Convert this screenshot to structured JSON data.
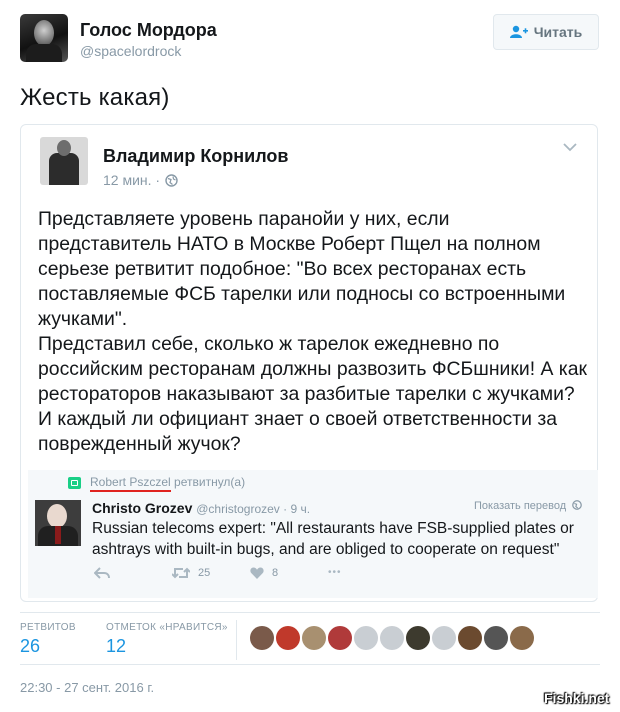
{
  "tweet": {
    "author_name": "Голос Мордора",
    "author_handle": "@spacelordrock",
    "follow_label": "Читать",
    "text": "Жесть какая)"
  },
  "quoted": {
    "name": "Владимир Корнилов",
    "time": "12 мин. ·",
    "paragraph1": "Представляете уровень паранойи у них, если представитель НАТО в Москве Роберт Пщел на полном серьезе ретвитит подобное: \"Во всех ресторанах есть поставляемые ФСБ тарелки или подносы со встроенными жучками\".",
    "paragraph2": "Представил себе, сколько ж тарелок ежедневно по российским ресторанам должны развозить ФСБшники! А как рестораторов наказывают за разбитые тарелки с жучками? И каждый ли официант знает о своей ответственности за поврежденный жучок?"
  },
  "inner": {
    "rt_user": "Robert Pszczel",
    "rt_suffix": "ретвитнул(а)",
    "name": "Christo Grozev",
    "handle": "@christogrozev · 9 ч.",
    "translate": "Показать перевод",
    "text": "Russian telecoms expert: \"All restaurants have FSB-supplied plates or ashtrays with built-in bugs, and are obliged to cooperate on request\"",
    "retweets": "25",
    "likes": "8",
    "more": "•••"
  },
  "stats": {
    "retweets_label": "РЕТВИТОВ",
    "retweets": "26",
    "likes_label": "ОТМЕТОК «НРАВИТСЯ»",
    "likes": "12"
  },
  "likers": [
    "#7a5a4a",
    "#c0392b",
    "#a89070",
    "#b03a3a",
    "#c9ced3",
    "#c9ced3",
    "#3d3a2e",
    "#c9ced3",
    "#6b4a2f",
    "#555",
    "#8a6a4a"
  ],
  "timestamp": "22:30 - 27 сент. 2016 г.",
  "watermark": "Fishki.net",
  "colors": {
    "link": "#1b95e0",
    "muted": "#8899a6",
    "retweet_green": "#19cf86",
    "underline_red": "#e0241f"
  }
}
